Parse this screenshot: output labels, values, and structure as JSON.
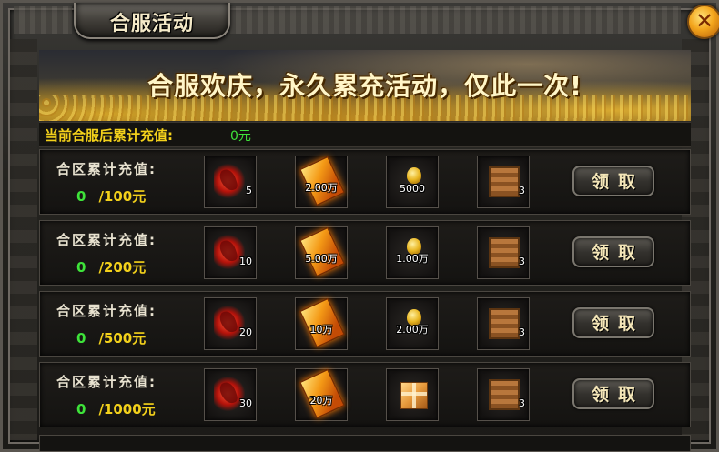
{
  "window": {
    "title": "合服活动",
    "close_icon": "close-icon"
  },
  "banner": {
    "text": "合服欢庆，永久累充活动，仅此一次!"
  },
  "summary": {
    "label": "当前合服后累计充值:",
    "value": "0元"
  },
  "tiers": [
    {
      "label": "合区累计充值:",
      "current": "0",
      "target": "/100元",
      "rewards": [
        {
          "icon": "red-wing-icon",
          "qty": "5"
        },
        {
          "icon": "fire-book-icon",
          "qty": "2.00万"
        },
        {
          "icon": "gold-ingot-icon",
          "qty": "5000"
        },
        {
          "icon": "treasure-chest-icon",
          "qty": "3"
        }
      ],
      "button": "领取"
    },
    {
      "label": "合区累计充值:",
      "current": "0",
      "target": "/200元",
      "rewards": [
        {
          "icon": "red-wing-icon",
          "qty": "10"
        },
        {
          "icon": "fire-book-icon",
          "qty": "5.00万"
        },
        {
          "icon": "gold-ingot-icon",
          "qty": "1.00万"
        },
        {
          "icon": "treasure-chest-icon",
          "qty": "3"
        }
      ],
      "button": "领取"
    },
    {
      "label": "合区累计充值:",
      "current": "0",
      "target": "/500元",
      "rewards": [
        {
          "icon": "red-wing-icon",
          "qty": "20"
        },
        {
          "icon": "fire-book-icon",
          "qty": "10万"
        },
        {
          "icon": "gold-ingot-icon",
          "qty": "2.00万"
        },
        {
          "icon": "treasure-chest-icon",
          "qty": "3"
        }
      ],
      "button": "领取"
    },
    {
      "label": "合区累计充值:",
      "current": "0",
      "target": "/1000元",
      "rewards": [
        {
          "icon": "red-wing-icon",
          "qty": "30"
        },
        {
          "icon": "fire-book-icon",
          "qty": "20万"
        },
        {
          "icon": "gift-box-icon",
          "qty": ""
        },
        {
          "icon": "treasure-chest-icon",
          "qty": "3"
        }
      ],
      "button": "领取"
    }
  ]
}
